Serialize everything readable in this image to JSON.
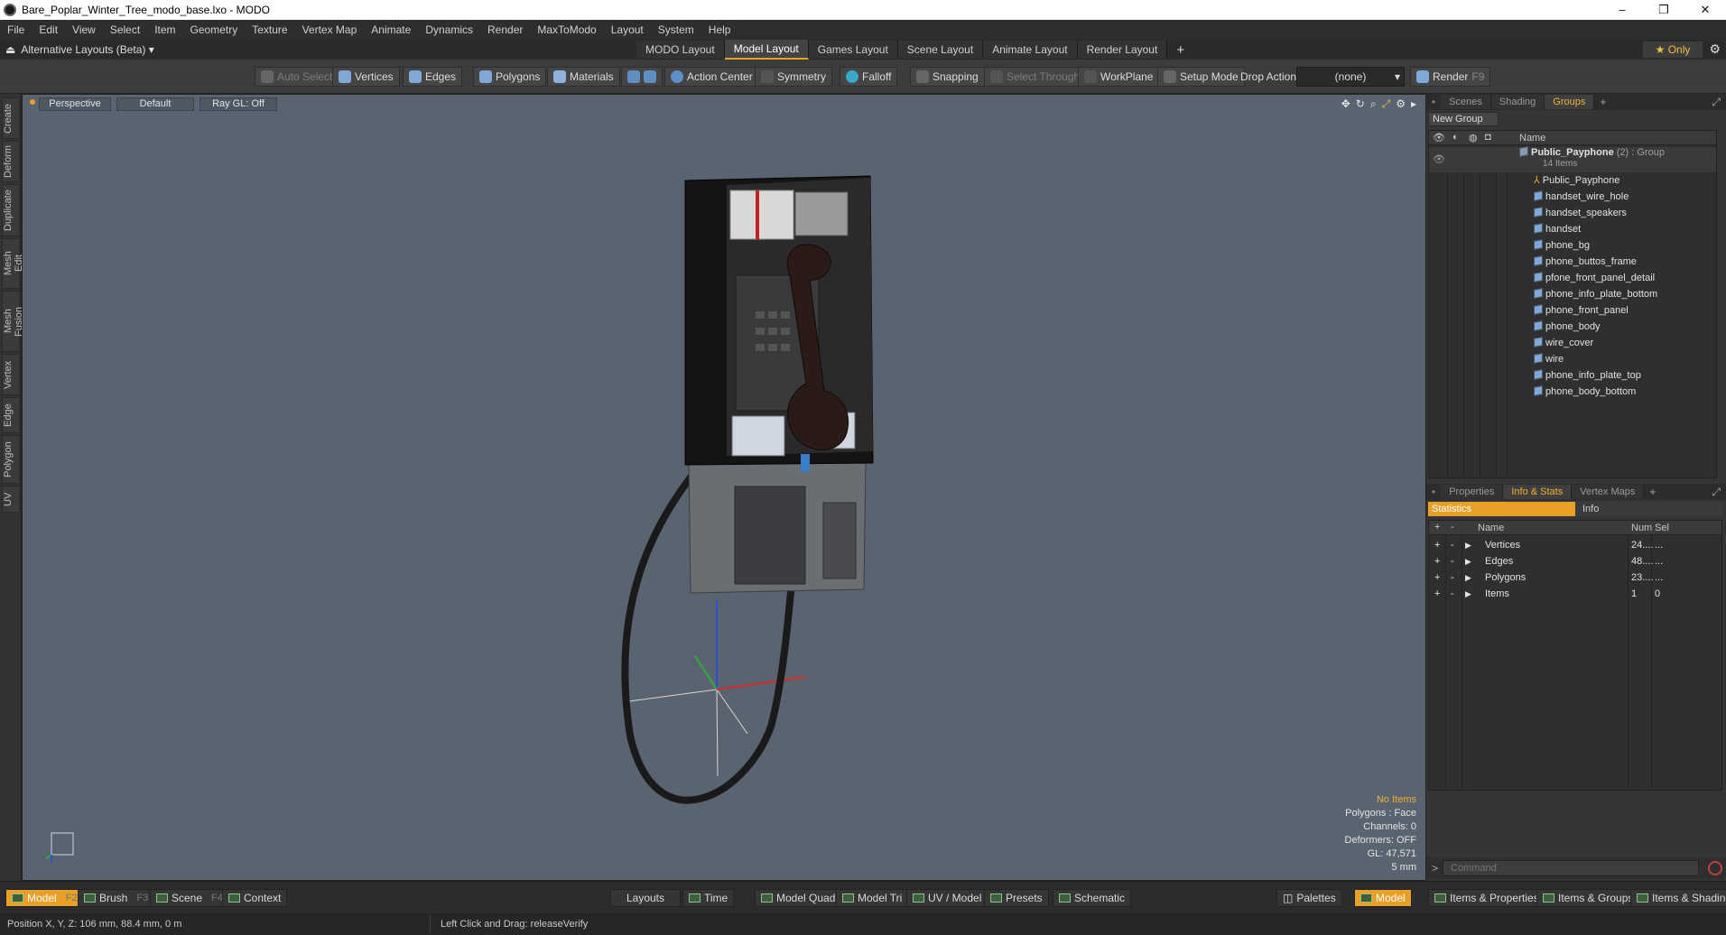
{
  "window": {
    "title": "Bare_Poplar_Winter_Tree_modo_base.lxo - MODO",
    "controls": [
      "–",
      "❐",
      "✕"
    ]
  },
  "menu": [
    "File",
    "Edit",
    "View",
    "Select",
    "Item",
    "Geometry",
    "Texture",
    "Vertex Map",
    "Animate",
    "Dynamics",
    "Render",
    "MaxToModo",
    "Layout",
    "System",
    "Help"
  ],
  "layoutbar": {
    "alt_layouts": "Alternative Layouts (Beta)",
    "tabs": [
      "MODO Layout",
      "Model Layout",
      "Games Layout",
      "Scene Layout",
      "Animate Layout",
      "Render Layout"
    ],
    "active_tab": "Model Layout",
    "only_label": "Only"
  },
  "toolbar": {
    "auto_select": "Auto Select",
    "vertices": "Vertices",
    "edges": "Edges",
    "polygons": "Polygons",
    "materials": "Materials",
    "action_center": "Action Center",
    "symmetry": "Symmetry",
    "falloff": "Falloff",
    "snapping": "Snapping",
    "select_through": "Select Through",
    "workplane": "WorkPlane",
    "setup_mode": "Setup Mode",
    "drop_action": "Drop Action",
    "drop_value": "(none)",
    "render": "Render",
    "render_key": "F9"
  },
  "left_tabs": [
    "Create",
    "Deform",
    "Duplicate",
    "Mesh Edit",
    "Mesh Fusion",
    "Vertex",
    "Edge",
    "Polygon",
    "UV"
  ],
  "viewport": {
    "view": "Perspective",
    "shading": "Default",
    "raygl": "Ray GL: Off",
    "stats": {
      "items": "No Items",
      "polygons": "Polygons : Face",
      "channels": "Channels: 0",
      "deformers": "Deformers: OFF",
      "gl": "GL: 47,571",
      "scale": "5 mm"
    }
  },
  "groups_panel": {
    "tabs": [
      "Scenes",
      "Shading",
      "Groups"
    ],
    "active_tab": "Groups",
    "new_group": "New Group",
    "col_name": "Name",
    "group_name": "Public_Payphone",
    "group_count": "(2)",
    "group_type": ": Group",
    "group_items": "14 Items",
    "items": [
      "Public_Payphone",
      "handset_wire_hole",
      "handset_speakers",
      "handset",
      "phone_bg",
      "phone_buttos_frame",
      "pfone_front_panel_detail",
      "phone_info_plate_bottom",
      "phone_front_panel",
      "phone_body",
      "wire_cover",
      "wire",
      "phone_info_plate_top",
      "phone_body_bottom"
    ]
  },
  "info_panel": {
    "tabs": [
      "Properties",
      "Info & Stats",
      "Vertex Maps"
    ],
    "active_tab": "Info & Stats",
    "subtabs": [
      "Statistics",
      "Info"
    ],
    "col_name": "Name",
    "col_num": "Num",
    "col_sel": "Sel",
    "rows": [
      {
        "name": "Vertices",
        "num": "24....",
        "sel": "..."
      },
      {
        "name": "Edges",
        "num": "48....",
        "sel": "..."
      },
      {
        "name": "Polygons",
        "num": "23....",
        "sel": "..."
      },
      {
        "name": "Items",
        "num": "1",
        "sel": "0"
      }
    ]
  },
  "command": {
    "placeholder": "Command"
  },
  "bottombar": {
    "model": "Model",
    "model_key": "F2",
    "brush": "Brush",
    "brush_key": "F3",
    "scene": "Scene",
    "scene_key": "F4",
    "context": "Context",
    "layouts": "Layouts",
    "time": "Time",
    "model_quad": "Model Quad",
    "model_tri": "Model Tri",
    "uv_model": "UV / Model",
    "presets": "Presets",
    "schematic": "Schematic",
    "palettes": "Palettes",
    "model_right": "Model",
    "items_properties": "Items & Properties",
    "items_groups": "Items & Groups",
    "items_shading": "Items & Shading"
  },
  "statusbar": {
    "position": "Position X, Y, Z:  106 mm, 88.4 mm, 0 m",
    "hint": "Left Click and Drag:   releaseVerify"
  }
}
